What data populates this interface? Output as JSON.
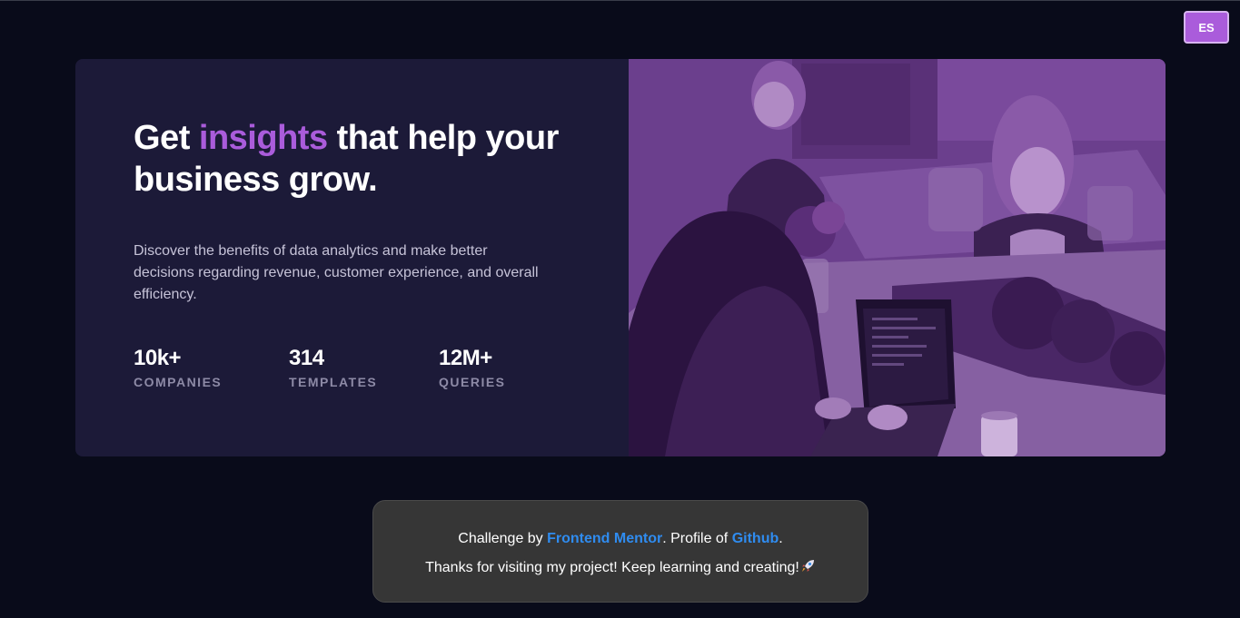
{
  "lang_button": {
    "label": "ES"
  },
  "hero": {
    "headline_before": "Get ",
    "headline_accent": "insights",
    "headline_after": " that help your business grow.",
    "description": "Discover the benefits of data analytics and make better decisions regarding revenue, customer experience, and overall efficiency.",
    "stats": [
      {
        "value": "10k+",
        "label": "COMPANIES"
      },
      {
        "value": "314",
        "label": "TEMPLATES"
      },
      {
        "value": "12M+",
        "label": "QUERIES"
      }
    ],
    "image_icon": "team-photo-image"
  },
  "footer": {
    "prefix": "Challenge by ",
    "frontend_link": "Frontend Mentor",
    "middle": ". Profile of ",
    "github_link": "Github",
    "suffix": ".",
    "thanks": "Thanks for visiting my project! Keep learning and creating!",
    "rocket_icon": "rocket-icon"
  },
  "colors": {
    "background": "#090b1a",
    "card": "#1c1a38",
    "accent": "#aa5cdb",
    "link": "#2f8cf0",
    "footer_box": "#363636"
  }
}
